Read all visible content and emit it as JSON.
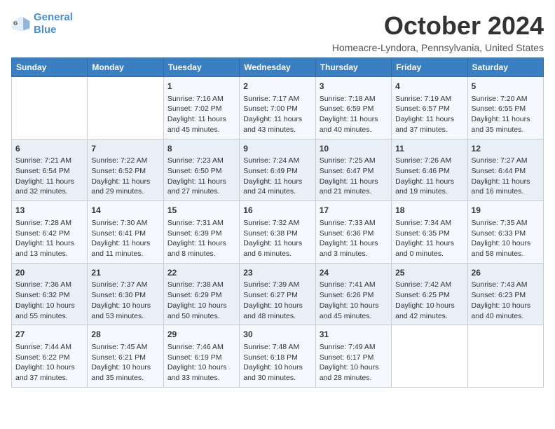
{
  "header": {
    "logo_line1": "General",
    "logo_line2": "Blue",
    "month": "October 2024",
    "location": "Homeacre-Lyndora, Pennsylvania, United States"
  },
  "days_of_week": [
    "Sunday",
    "Monday",
    "Tuesday",
    "Wednesday",
    "Thursday",
    "Friday",
    "Saturday"
  ],
  "weeks": [
    [
      {
        "day": "",
        "sunrise": "",
        "sunset": "",
        "daylight": ""
      },
      {
        "day": "",
        "sunrise": "",
        "sunset": "",
        "daylight": ""
      },
      {
        "day": "1",
        "sunrise": "Sunrise: 7:16 AM",
        "sunset": "Sunset: 7:02 PM",
        "daylight": "Daylight: 11 hours and 45 minutes."
      },
      {
        "day": "2",
        "sunrise": "Sunrise: 7:17 AM",
        "sunset": "Sunset: 7:00 PM",
        "daylight": "Daylight: 11 hours and 43 minutes."
      },
      {
        "day": "3",
        "sunrise": "Sunrise: 7:18 AM",
        "sunset": "Sunset: 6:59 PM",
        "daylight": "Daylight: 11 hours and 40 minutes."
      },
      {
        "day": "4",
        "sunrise": "Sunrise: 7:19 AM",
        "sunset": "Sunset: 6:57 PM",
        "daylight": "Daylight: 11 hours and 37 minutes."
      },
      {
        "day": "5",
        "sunrise": "Sunrise: 7:20 AM",
        "sunset": "Sunset: 6:55 PM",
        "daylight": "Daylight: 11 hours and 35 minutes."
      }
    ],
    [
      {
        "day": "6",
        "sunrise": "Sunrise: 7:21 AM",
        "sunset": "Sunset: 6:54 PM",
        "daylight": "Daylight: 11 hours and 32 minutes."
      },
      {
        "day": "7",
        "sunrise": "Sunrise: 7:22 AM",
        "sunset": "Sunset: 6:52 PM",
        "daylight": "Daylight: 11 hours and 29 minutes."
      },
      {
        "day": "8",
        "sunrise": "Sunrise: 7:23 AM",
        "sunset": "Sunset: 6:50 PM",
        "daylight": "Daylight: 11 hours and 27 minutes."
      },
      {
        "day": "9",
        "sunrise": "Sunrise: 7:24 AM",
        "sunset": "Sunset: 6:49 PM",
        "daylight": "Daylight: 11 hours and 24 minutes."
      },
      {
        "day": "10",
        "sunrise": "Sunrise: 7:25 AM",
        "sunset": "Sunset: 6:47 PM",
        "daylight": "Daylight: 11 hours and 21 minutes."
      },
      {
        "day": "11",
        "sunrise": "Sunrise: 7:26 AM",
        "sunset": "Sunset: 6:46 PM",
        "daylight": "Daylight: 11 hours and 19 minutes."
      },
      {
        "day": "12",
        "sunrise": "Sunrise: 7:27 AM",
        "sunset": "Sunset: 6:44 PM",
        "daylight": "Daylight: 11 hours and 16 minutes."
      }
    ],
    [
      {
        "day": "13",
        "sunrise": "Sunrise: 7:28 AM",
        "sunset": "Sunset: 6:42 PM",
        "daylight": "Daylight: 11 hours and 13 minutes."
      },
      {
        "day": "14",
        "sunrise": "Sunrise: 7:30 AM",
        "sunset": "Sunset: 6:41 PM",
        "daylight": "Daylight: 11 hours and 11 minutes."
      },
      {
        "day": "15",
        "sunrise": "Sunrise: 7:31 AM",
        "sunset": "Sunset: 6:39 PM",
        "daylight": "Daylight: 11 hours and 8 minutes."
      },
      {
        "day": "16",
        "sunrise": "Sunrise: 7:32 AM",
        "sunset": "Sunset: 6:38 PM",
        "daylight": "Daylight: 11 hours and 6 minutes."
      },
      {
        "day": "17",
        "sunrise": "Sunrise: 7:33 AM",
        "sunset": "Sunset: 6:36 PM",
        "daylight": "Daylight: 11 hours and 3 minutes."
      },
      {
        "day": "18",
        "sunrise": "Sunrise: 7:34 AM",
        "sunset": "Sunset: 6:35 PM",
        "daylight": "Daylight: 11 hours and 0 minutes."
      },
      {
        "day": "19",
        "sunrise": "Sunrise: 7:35 AM",
        "sunset": "Sunset: 6:33 PM",
        "daylight": "Daylight: 10 hours and 58 minutes."
      }
    ],
    [
      {
        "day": "20",
        "sunrise": "Sunrise: 7:36 AM",
        "sunset": "Sunset: 6:32 PM",
        "daylight": "Daylight: 10 hours and 55 minutes."
      },
      {
        "day": "21",
        "sunrise": "Sunrise: 7:37 AM",
        "sunset": "Sunset: 6:30 PM",
        "daylight": "Daylight: 10 hours and 53 minutes."
      },
      {
        "day": "22",
        "sunrise": "Sunrise: 7:38 AM",
        "sunset": "Sunset: 6:29 PM",
        "daylight": "Daylight: 10 hours and 50 minutes."
      },
      {
        "day": "23",
        "sunrise": "Sunrise: 7:39 AM",
        "sunset": "Sunset: 6:27 PM",
        "daylight": "Daylight: 10 hours and 48 minutes."
      },
      {
        "day": "24",
        "sunrise": "Sunrise: 7:41 AM",
        "sunset": "Sunset: 6:26 PM",
        "daylight": "Daylight: 10 hours and 45 minutes."
      },
      {
        "day": "25",
        "sunrise": "Sunrise: 7:42 AM",
        "sunset": "Sunset: 6:25 PM",
        "daylight": "Daylight: 10 hours and 42 minutes."
      },
      {
        "day": "26",
        "sunrise": "Sunrise: 7:43 AM",
        "sunset": "Sunset: 6:23 PM",
        "daylight": "Daylight: 10 hours and 40 minutes."
      }
    ],
    [
      {
        "day": "27",
        "sunrise": "Sunrise: 7:44 AM",
        "sunset": "Sunset: 6:22 PM",
        "daylight": "Daylight: 10 hours and 37 minutes."
      },
      {
        "day": "28",
        "sunrise": "Sunrise: 7:45 AM",
        "sunset": "Sunset: 6:21 PM",
        "daylight": "Daylight: 10 hours and 35 minutes."
      },
      {
        "day": "29",
        "sunrise": "Sunrise: 7:46 AM",
        "sunset": "Sunset: 6:19 PM",
        "daylight": "Daylight: 10 hours and 33 minutes."
      },
      {
        "day": "30",
        "sunrise": "Sunrise: 7:48 AM",
        "sunset": "Sunset: 6:18 PM",
        "daylight": "Daylight: 10 hours and 30 minutes."
      },
      {
        "day": "31",
        "sunrise": "Sunrise: 7:49 AM",
        "sunset": "Sunset: 6:17 PM",
        "daylight": "Daylight: 10 hours and 28 minutes."
      },
      {
        "day": "",
        "sunrise": "",
        "sunset": "",
        "daylight": ""
      },
      {
        "day": "",
        "sunrise": "",
        "sunset": "",
        "daylight": ""
      }
    ]
  ]
}
